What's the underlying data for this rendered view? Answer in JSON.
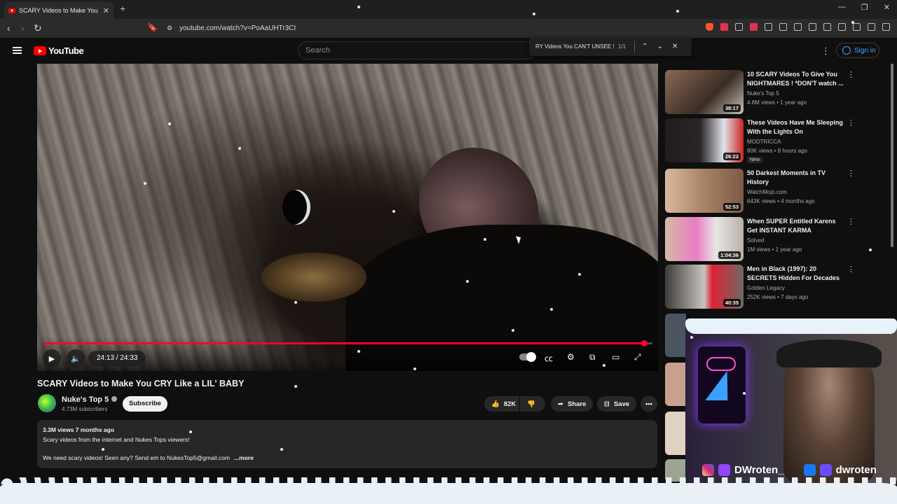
{
  "browser": {
    "tab_title": "SCARY Videos to Make You C",
    "url": "youtube.com/watch?v=PoAaUHTr3CI",
    "new_tab": "+"
  },
  "header": {
    "logo": "YouTube",
    "search_placeholder": "Search",
    "sign_in": "Sign in"
  },
  "find_bar": {
    "query": "RY Videos You CAN'T UNSEE !",
    "count": "1/1"
  },
  "player": {
    "time": "24:13 / 24:33",
    "progress": 0.986
  },
  "video": {
    "title": "SCARY Videos to Make You CRY Like a LIL' BABY",
    "channel": "Nuke's Top 5",
    "subscribers": "4.73M subscribers",
    "subscribe": "Subscribe",
    "likes": "82K",
    "share": "Share",
    "save": "Save",
    "stats": "3.3M views  7 months ago",
    "desc_line1": "Scary videos from the internet and Nukes Tops viewers!",
    "desc_line2": "We need scary videos! Seen any? Send em to NukesTop5@gmail.com",
    "more": "...more"
  },
  "recommendations": [
    {
      "title": "10 SCARY Videos To Give You NIGHTMARES ! *DON'T watch ...",
      "channel": "Nuke's Top 5",
      "meta": "4.8M views • 1 year ago",
      "duration": "38:17",
      "badge": ""
    },
    {
      "title": "These Videos Have Me Sleeping With the Lights On",
      "channel": "MODTRICCA",
      "meta": "80K views • 8 hours ago",
      "duration": "26:22",
      "badge": "New"
    },
    {
      "title": "50 Darkest Moments in TV History",
      "channel": "WatchMojo.com",
      "meta": "643K views • 4 months ago",
      "duration": "52:53",
      "badge": ""
    },
    {
      "title": "When SUPER Entitled Karens Get INSTANT KARMA",
      "channel": "Solved",
      "meta": "1M views • 1 year ago",
      "duration": "1:04:36",
      "badge": ""
    },
    {
      "title": "Men in Black (1997): 20 SECRETS Hidden For Decades",
      "channel": "Golden Legacy",
      "meta": "252K views • 7 days ago",
      "duration": "40:35",
      "badge": ""
    }
  ],
  "overlay": {
    "handle1": "DWroten_",
    "handle2": "dwroten"
  }
}
